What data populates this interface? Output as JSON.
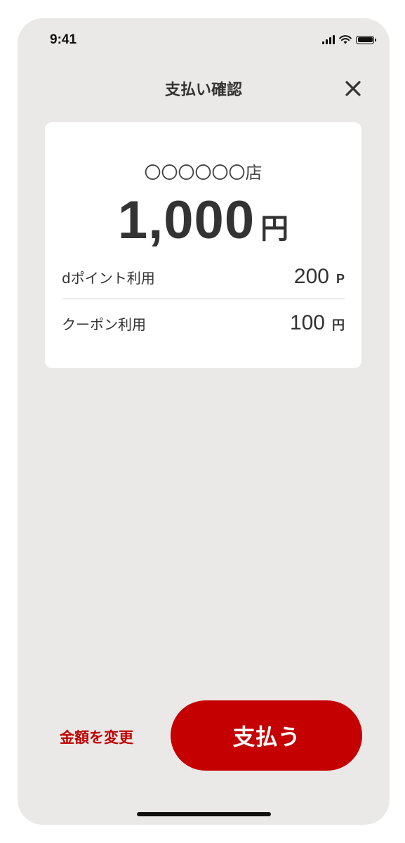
{
  "status_bar": {
    "time": "9:41",
    "icons": [
      "signal-icon",
      "wifi-icon",
      "battery-icon"
    ]
  },
  "header": {
    "title": "支払い確認",
    "close_icon": "close-icon"
  },
  "summary": {
    "store_name": "〇〇〇〇〇〇店",
    "amount": "1,000",
    "amount_unit": "円",
    "items": [
      {
        "label": "dポイント利用",
        "value": "200",
        "unit": "P"
      },
      {
        "label": "クーポン利用",
        "value": "100",
        "unit": "円"
      }
    ]
  },
  "actions": {
    "change_amount_label": "金額を変更",
    "pay_label": "支払う"
  },
  "colors": {
    "accent": "#c40000",
    "background": "#ebe9e7",
    "card": "#ffffff"
  }
}
